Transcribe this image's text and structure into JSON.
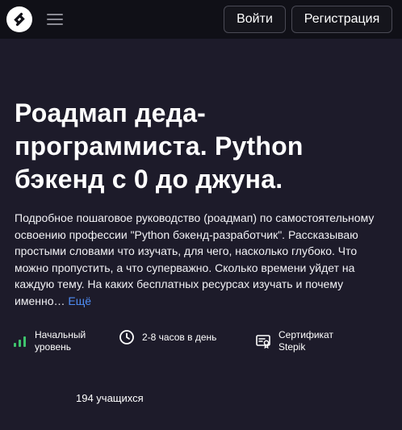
{
  "header": {
    "login_label": "Войти",
    "register_label": "Регистрация"
  },
  "course": {
    "title_line1": "Роадмап деда-",
    "title_line2": "программиста. Python",
    "title_line3": "бэкенд с 0 до джуна.",
    "description": "Подробное пошаговое руководство (роадмап) по самостоятельному освоению профессии \"Python бэкенд-разработчик\". Рассказываю простыми словами что изучать, для чего, насколько глубоко. Что можно пропустить, а что суперважно. Сколько времени уйдет на каждую тему. На каких бесплатных ресурсах изучать и почему именно…",
    "more_label": "Ещё"
  },
  "features": {
    "level_line1": "Начальный",
    "level_line2": "уровень",
    "time": "2-8 часов в день",
    "cert_line1": "Сертификат",
    "cert_line2": "Stepik"
  },
  "students": "194 учащихся",
  "colors": {
    "background": "#1d1b2a",
    "topbar": "#101017",
    "link": "#4f8df5",
    "level_active": "#3ec46d"
  },
  "icons": [
    "stepik-logo-icon",
    "menu-icon",
    "level-bars-icon",
    "clock-icon",
    "certificate-icon"
  ]
}
